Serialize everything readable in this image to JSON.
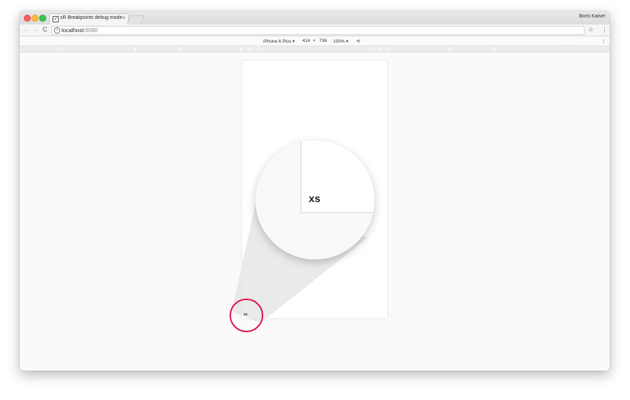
{
  "browser": {
    "tab_title": "sR Breakpoints debug mode",
    "tab_close": "×",
    "tab_checkbox": "✓",
    "user_name": "Boris Kaiser",
    "url_host": "localhost",
    "url_port": ":8080",
    "info_icon": "i",
    "nav_back": "←",
    "nav_forward": "→",
    "nav_reload": "C",
    "bookmark_star": "☆",
    "menu_dots": "⋮"
  },
  "device_toolbar": {
    "device": "iPhone 6 Plus ▾",
    "width": "414",
    "times": "×",
    "height": "736",
    "zoom": "100% ▾",
    "rotate_icon": "⟲",
    "more": "⋮"
  },
  "page": {
    "breakpoint_small": "xs",
    "breakpoint_zoomed": "xs"
  },
  "colors": {
    "highlight_ring": "#e0144a"
  }
}
